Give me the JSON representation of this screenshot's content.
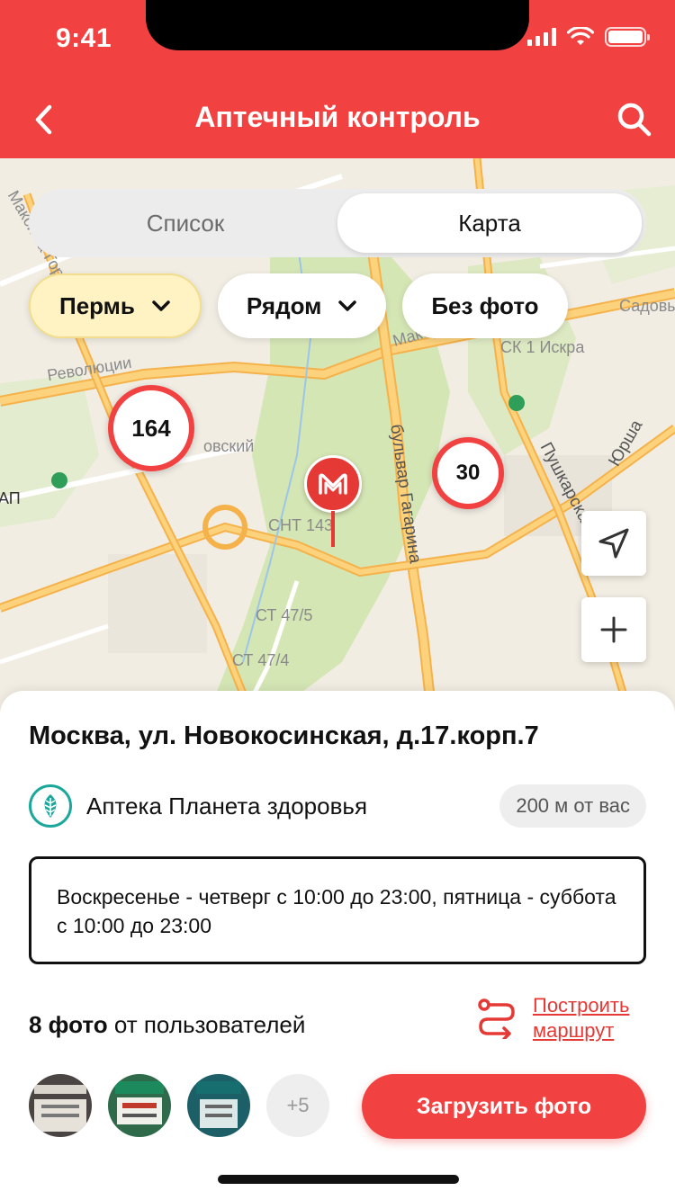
{
  "status_bar": {
    "time": "9:41"
  },
  "header": {
    "title": "Аптечный контроль",
    "back_icon": "chevron-left-icon",
    "search_icon": "search-icon",
    "background": "#F24141"
  },
  "view_toggle": {
    "options": [
      "Список",
      "Карта"
    ],
    "selected": "Карта"
  },
  "filters": [
    {
      "label": "Пермь",
      "has_dropdown": true,
      "selected": true
    },
    {
      "label": "Рядом",
      "has_dropdown": true,
      "selected": false
    },
    {
      "label": "Без фото",
      "has_dropdown": false,
      "selected": false
    }
  ],
  "map": {
    "labels": {
      "revolution": "Революции",
      "maxim": "Максима Гор",
      "makar": "Макар",
      "sadov": "Садовы",
      "sk_iskra": "СК 1 Искра",
      "gagarin": "бульвар Гагарина",
      "pushkar": "Пушкарская",
      "yursha": "Юрша",
      "snt143": "СНТ 143",
      "st475": "СТ 47/5",
      "st474": "СТ 47/4",
      "ovsky": "овский",
      "ap": "АП"
    },
    "clusters": [
      {
        "count": "164"
      },
      {
        "count": "30"
      }
    ],
    "selected_pin_icon": "pharmacy-m-icon",
    "controls": [
      "location-arrow-icon",
      "zoom-in-icon"
    ]
  },
  "details": {
    "address": "Москва, ул. Новокосинская, д.17.корп.7",
    "pharmacy_name": "Аптека Планета здоровья",
    "distance": "200 м от вас",
    "hours": "Воскресенье - четверг с 10:00 до 23:00, пятница - суббота с 10:00 до 23:00",
    "photos_count": "8 фото",
    "photos_suffix": " от пользователей",
    "route_line1": "Построить",
    "route_line2": "маршрут",
    "thumb_more": "+5",
    "upload_label": "Загрузить фото",
    "accent_color": "#F24141"
  }
}
